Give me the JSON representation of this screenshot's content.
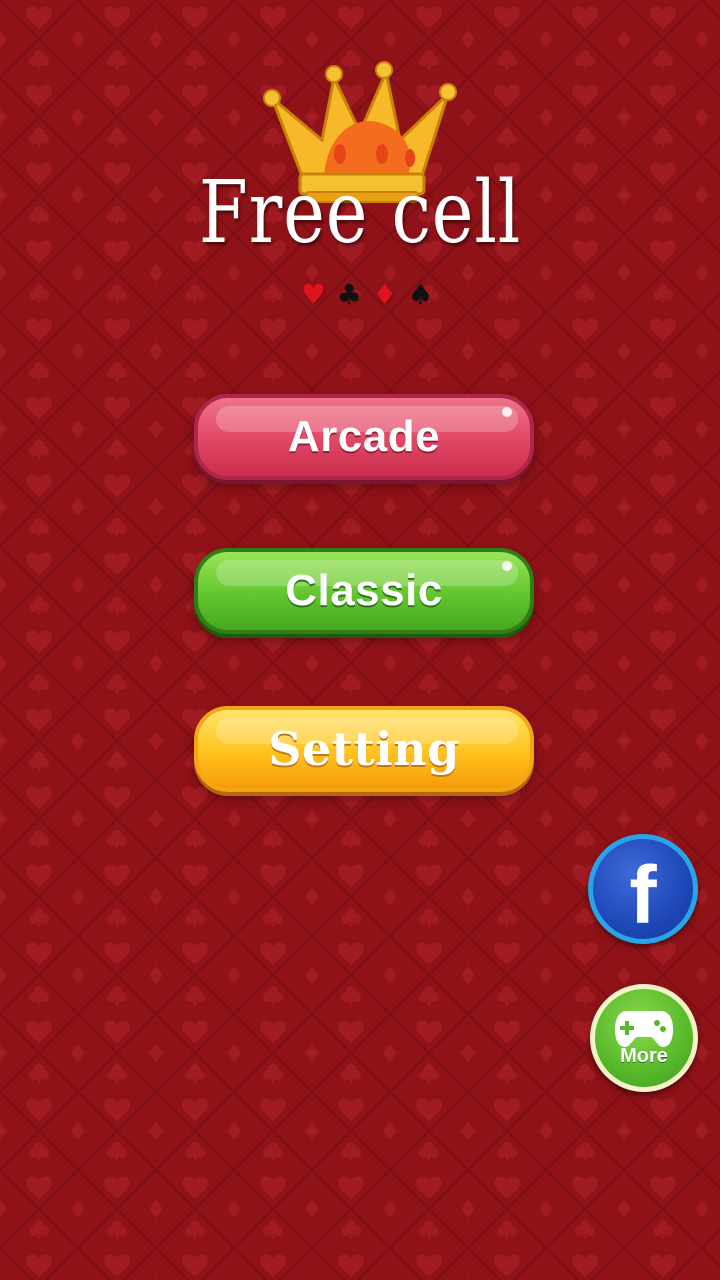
{
  "title": "Free cell",
  "suits": [
    {
      "glyph": "♥",
      "color": "#e0141e"
    },
    {
      "glyph": "♣",
      "color": "#111111"
    },
    {
      "glyph": "♦",
      "color": "#e0141e"
    },
    {
      "glyph": "♠",
      "color": "#111111"
    }
  ],
  "menu": {
    "arcade_label": "Arcade",
    "classic_label": "Classic",
    "setting_label": "Setting"
  },
  "social": {
    "facebook_glyph": "f",
    "more_label": "More"
  },
  "icons": {
    "crown": "crown-icon",
    "facebook": "facebook-icon",
    "gamepad": "gamepad-icon"
  },
  "colors": {
    "background": "#8e1218",
    "arcade": "#e14763",
    "classic": "#62c52f",
    "setting": "#ffc21e",
    "facebook": "#1e47b7",
    "more": "#57b82a"
  }
}
